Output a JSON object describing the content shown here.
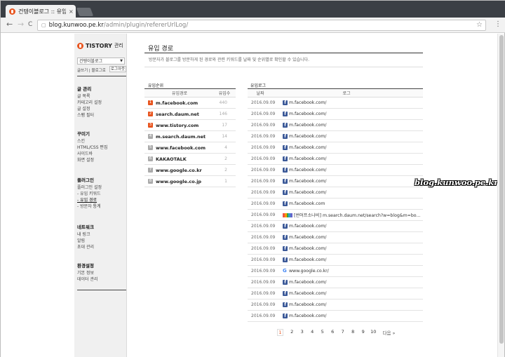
{
  "browser": {
    "tab_title": "건텡이블로그 :: 유입",
    "tab_close": "×",
    "url_domain": "blog.kunwoo.pe.kr",
    "url_path": "/admin/plugin/refererUrlLog/",
    "back_glyph": "←",
    "forward_glyph": "→",
    "reload_glyph": "C",
    "star_glyph": "☆",
    "menu_glyph": "⋮"
  },
  "sidebar": {
    "logo": "TISTORY",
    "logo_suffix": "관리",
    "blog_select": "건텡이블로그",
    "sublinks": "글쓰기 | 블로그로",
    "logout": "로그아웃",
    "sections": [
      {
        "heading": "글 관리",
        "items": [
          "글 목록",
          "카테고리 설정",
          "글 설정",
          "스팸 필터"
        ]
      },
      {
        "heading": "꾸미기",
        "items": [
          "스킨",
          "HTML/CSS 편집",
          "사이드바",
          "화면 설정"
        ]
      },
      {
        "heading": "플러그인",
        "items": [
          "플러그인 설정",
          "- 유입 키워드",
          "- 유입 경로",
          "- 방문자 통계"
        ]
      },
      {
        "heading": "네트워크",
        "items": [
          "내 링크",
          "알림",
          "초대 관리"
        ]
      },
      {
        "heading": "환경설정",
        "items": [
          "기본 정보",
          "데이터 관리"
        ]
      }
    ]
  },
  "main": {
    "title": "유입 경로",
    "description": "방문자가 블로그를 방문하게 된 경로와 관련 키워드를 날짜 및 순위별로 확인할 수 있습니다."
  },
  "rank_table": {
    "label": "유입순위",
    "headers": [
      "유입경로",
      "유입수"
    ],
    "rows": [
      {
        "rank": "1",
        "source": "m.facebook.com",
        "count": "440"
      },
      {
        "rank": "2",
        "source": "search.daum.net",
        "count": "146"
      },
      {
        "rank": "3",
        "source": "www.tistory.com",
        "count": "17"
      },
      {
        "rank": "4",
        "source": "m.search.daum.net",
        "count": "14"
      },
      {
        "rank": "5",
        "source": "www.facebook.com",
        "count": "4"
      },
      {
        "rank": "6",
        "source": "KAKAOTALK",
        "count": "2"
      },
      {
        "rank": "7",
        "source": "www.google.co.kr",
        "count": "2"
      },
      {
        "rank": "8",
        "source": "www.google.co.jp",
        "count": "1"
      }
    ]
  },
  "log_table": {
    "label": "유입로그",
    "headers": [
      "날짜",
      "로그"
    ],
    "rows": [
      {
        "date": "2016.09.09",
        "icon": "facebook",
        "log": "m.facebook.com/"
      },
      {
        "date": "2016.09.09",
        "icon": "facebook",
        "log": "m.facebook.com/"
      },
      {
        "date": "2016.09.09",
        "icon": "facebook",
        "log": "m.facebook.com/"
      },
      {
        "date": "2016.09.09",
        "icon": "facebook",
        "log": "m.facebook.com/"
      },
      {
        "date": "2016.09.09",
        "icon": "facebook",
        "log": "m.facebook.com/"
      },
      {
        "date": "2016.09.09",
        "icon": "facebook",
        "log": "m.facebook.com/"
      },
      {
        "date": "2016.09.09",
        "icon": "facebook",
        "log": "m.facebook.com/"
      },
      {
        "date": "2016.09.09",
        "icon": "facebook",
        "log": "m.facebook.com/"
      },
      {
        "date": "2016.09.09",
        "icon": "facebook",
        "log": "m.facebook.com/"
      },
      {
        "date": "2016.09.09",
        "icon": "facebook",
        "log": "m.facebook.com"
      },
      {
        "date": "2016.09.09",
        "icon": "daum",
        "log": "[썬어프소나비] m.search.daum.net/search?w=blog&m=bo..."
      },
      {
        "date": "2016.09.09",
        "icon": "facebook",
        "log": "m.facebook.com/"
      },
      {
        "date": "2016.09.09",
        "icon": "facebook",
        "log": "m.facebook.com/"
      },
      {
        "date": "2016.09.09",
        "icon": "facebook",
        "log": "m.facebook.com/"
      },
      {
        "date": "2016.09.09",
        "icon": "facebook",
        "log": "m.facebook.com/"
      },
      {
        "date": "2016.09.09",
        "icon": "google",
        "log": "www.google.co.kr/"
      },
      {
        "date": "2016.09.09",
        "icon": "facebook",
        "log": "m.facebook.com/"
      },
      {
        "date": "2016.09.09",
        "icon": "facebook",
        "log": "m.facebook.com/"
      },
      {
        "date": "2016.09.09",
        "icon": "facebook",
        "log": "m.facebook.com/"
      },
      {
        "date": "2016.09.09",
        "icon": "facebook",
        "log": "m.facebook.com/"
      }
    ]
  },
  "pagination": {
    "pages": [
      "1",
      "2",
      "3",
      "4",
      "5",
      "6",
      "7",
      "8",
      "9",
      "10"
    ],
    "current": "1",
    "next": "다음 »"
  },
  "watermark": "blog.kunwoo.pe.kr",
  "colors": {
    "accent": "#e8541e",
    "facebook": "#3b5998",
    "google": "#4285f4"
  }
}
